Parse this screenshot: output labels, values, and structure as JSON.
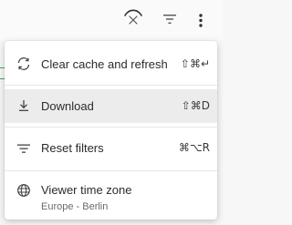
{
  "toolbar": {
    "icons": [
      "loading-spinner-icon",
      "filter-icon",
      "more-vert-icon"
    ]
  },
  "menu": {
    "items": [
      {
        "icon": "refresh-icon",
        "label": "Clear cache and refresh",
        "shortcut": "⇧⌘↵"
      },
      {
        "icon": "download-icon",
        "label": "Download",
        "shortcut": "⇧⌘D",
        "highlighted": true
      },
      {
        "icon": "filter-lines-icon",
        "label": "Reset filters",
        "shortcut": "⌘⌥R"
      },
      {
        "icon": "globe-icon",
        "label": "Viewer time zone",
        "sublabel": "Europe - Berlin"
      }
    ]
  },
  "colors": {
    "highlight": "#ececec",
    "text": "#2b2b2b",
    "subtext": "#6b6b6b"
  }
}
